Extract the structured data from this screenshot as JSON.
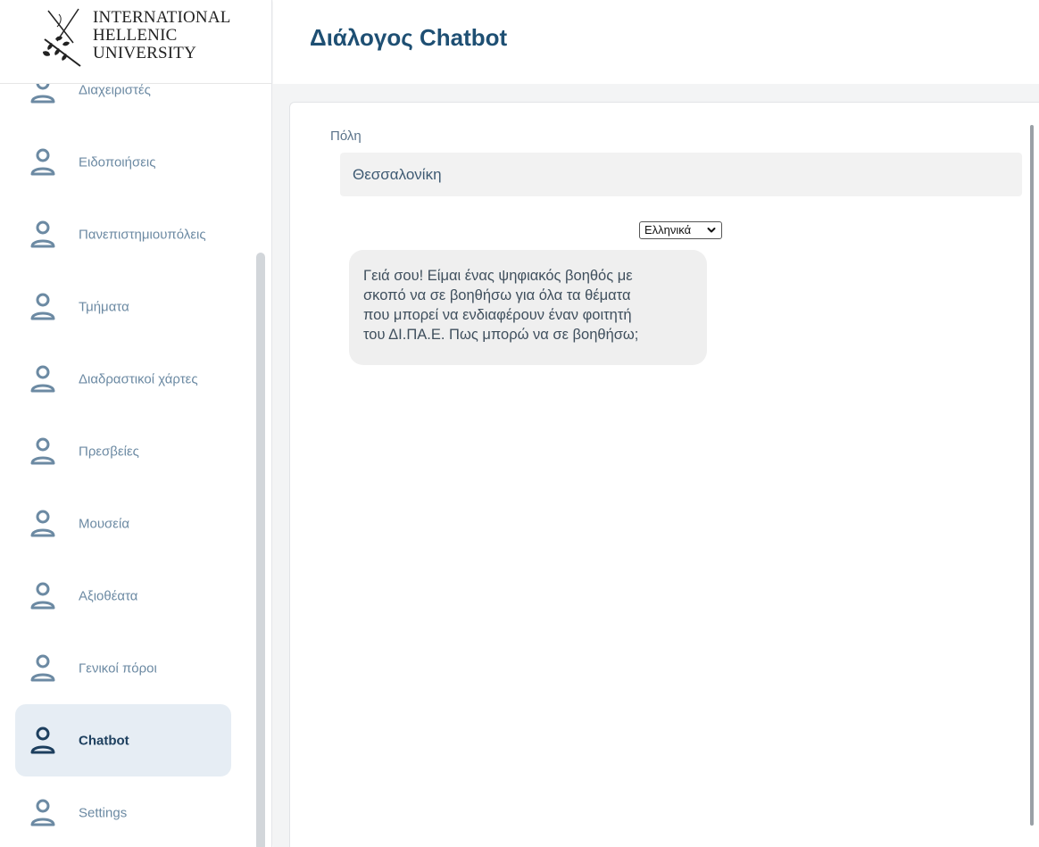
{
  "logo": {
    "line1": "INTERNATIONAL",
    "line2": "HELLENIC",
    "line3": "UNIVERSITY"
  },
  "sidebar": {
    "items": [
      {
        "label": "Διαχειριστές",
        "icon": "user-icon",
        "active": false
      },
      {
        "label": "Ειδοποιήσεις",
        "icon": "user-icon",
        "active": false
      },
      {
        "label": "Πανεπιστημιουπόλεις",
        "icon": "user-icon",
        "active": false
      },
      {
        "label": "Τμήματα",
        "icon": "user-icon",
        "active": false
      },
      {
        "label": "Διαδραστικοί χάρτες",
        "icon": "user-icon",
        "active": false
      },
      {
        "label": "Πρεσβείες",
        "icon": "user-icon",
        "active": false
      },
      {
        "label": "Μουσεία",
        "icon": "user-icon",
        "active": false
      },
      {
        "label": "Αξιοθέατα",
        "icon": "user-icon",
        "active": false
      },
      {
        "label": "Γενικοί πόροι",
        "icon": "user-icon",
        "active": false
      },
      {
        "label": "Chatbot",
        "icon": "user-icon",
        "active": true
      },
      {
        "label": "Settings",
        "icon": "user-icon",
        "active": false
      }
    ]
  },
  "header": {
    "title": "Διάλογος Chatbot"
  },
  "form": {
    "city_label": "Πόλη",
    "city_value": "Θεσσαλονίκη"
  },
  "language": {
    "selected": "Ελληνικά"
  },
  "chat": {
    "messages": [
      {
        "line1": "Γειά σου! Είμαι ένας ψηφιακός βοηθός με",
        "line2": "σκοπό να σε βοηθήσω για όλα τα θέματα",
        "line3": "που μπορεί να ενδιαφέρουν έναν φοιτητή",
        "line4": "του ΔΙ.ΠΑ.Ε. Πως μπορώ να σε βοηθήσω;"
      }
    ]
  },
  "colors": {
    "accent": "#1e4f73",
    "sidebar_label": "#6c8aa3",
    "active_bg": "#e6edf4",
    "bubble_bg": "#efefef"
  }
}
